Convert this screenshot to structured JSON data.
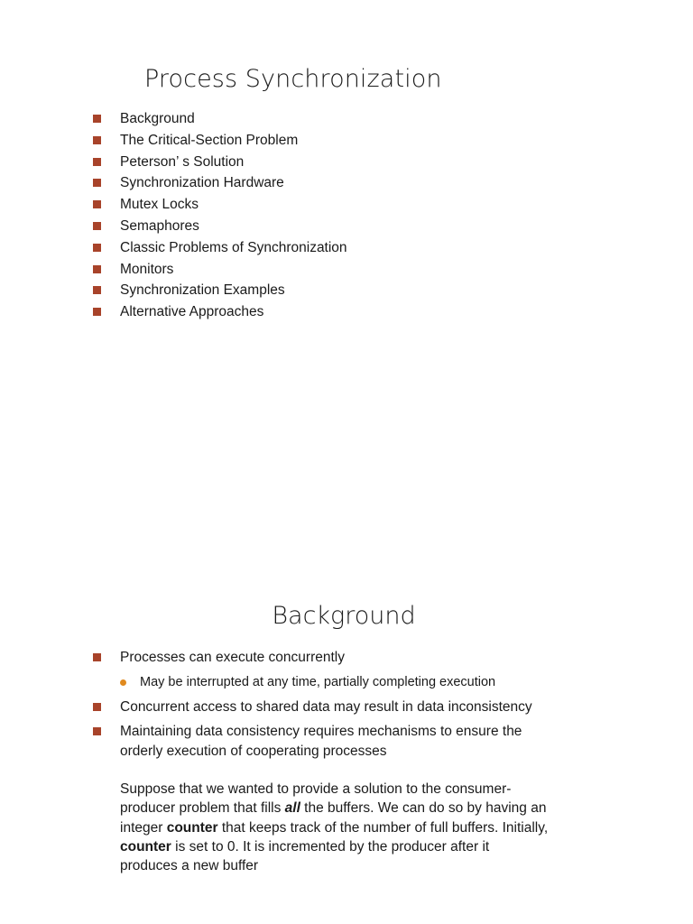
{
  "slide_one": {
    "title": "Process Synchronization",
    "bullet_marker_color": "#A8432A",
    "agenda": [
      {
        "label": "Background"
      },
      {
        "label": "The Critical-Section Problem"
      },
      {
        "label": "Peterson’ s Solution"
      },
      {
        "label": "Synchronization Hardware"
      },
      {
        "label": "Mutex Locks"
      },
      {
        "label": "Semaphores"
      },
      {
        "label": "Classic Problems of Synchronization"
      },
      {
        "label": "Monitors"
      },
      {
        "label": "Synchronization Examples"
      },
      {
        "label": "Alternative Approaches"
      }
    ]
  },
  "slide_two": {
    "title": "Background",
    "bullet_marker_color": "#A8432A",
    "sub_bullet_marker_color": "#E08A1E",
    "bullets": [
      {
        "level": 1,
        "text": "Processes can execute concurrently"
      },
      {
        "level": 2,
        "text": "May be interrupted at any time, partially completing execution"
      },
      {
        "level": 1,
        "text": "Concurrent access to shared data may result in data inconsistency"
      },
      {
        "level": 1,
        "text": "Maintaining data consistency requires mechanisms to ensure the orderly execution of cooperating processes"
      }
    ],
    "closing_paragraph": {
      "part1": "Suppose that we wanted to provide a solution to the consumer-producer problem that fills ",
      "emphasis1": "all",
      "part2": " the buffers. We can do so by having an integer ",
      "emphasis2": "counter",
      "part3": " that keeps track of the number of full buffers. Initially, ",
      "emphasis3": "counter",
      "part4": " is set to 0. It is incremented by the producer after it produces a new buffer"
    }
  }
}
